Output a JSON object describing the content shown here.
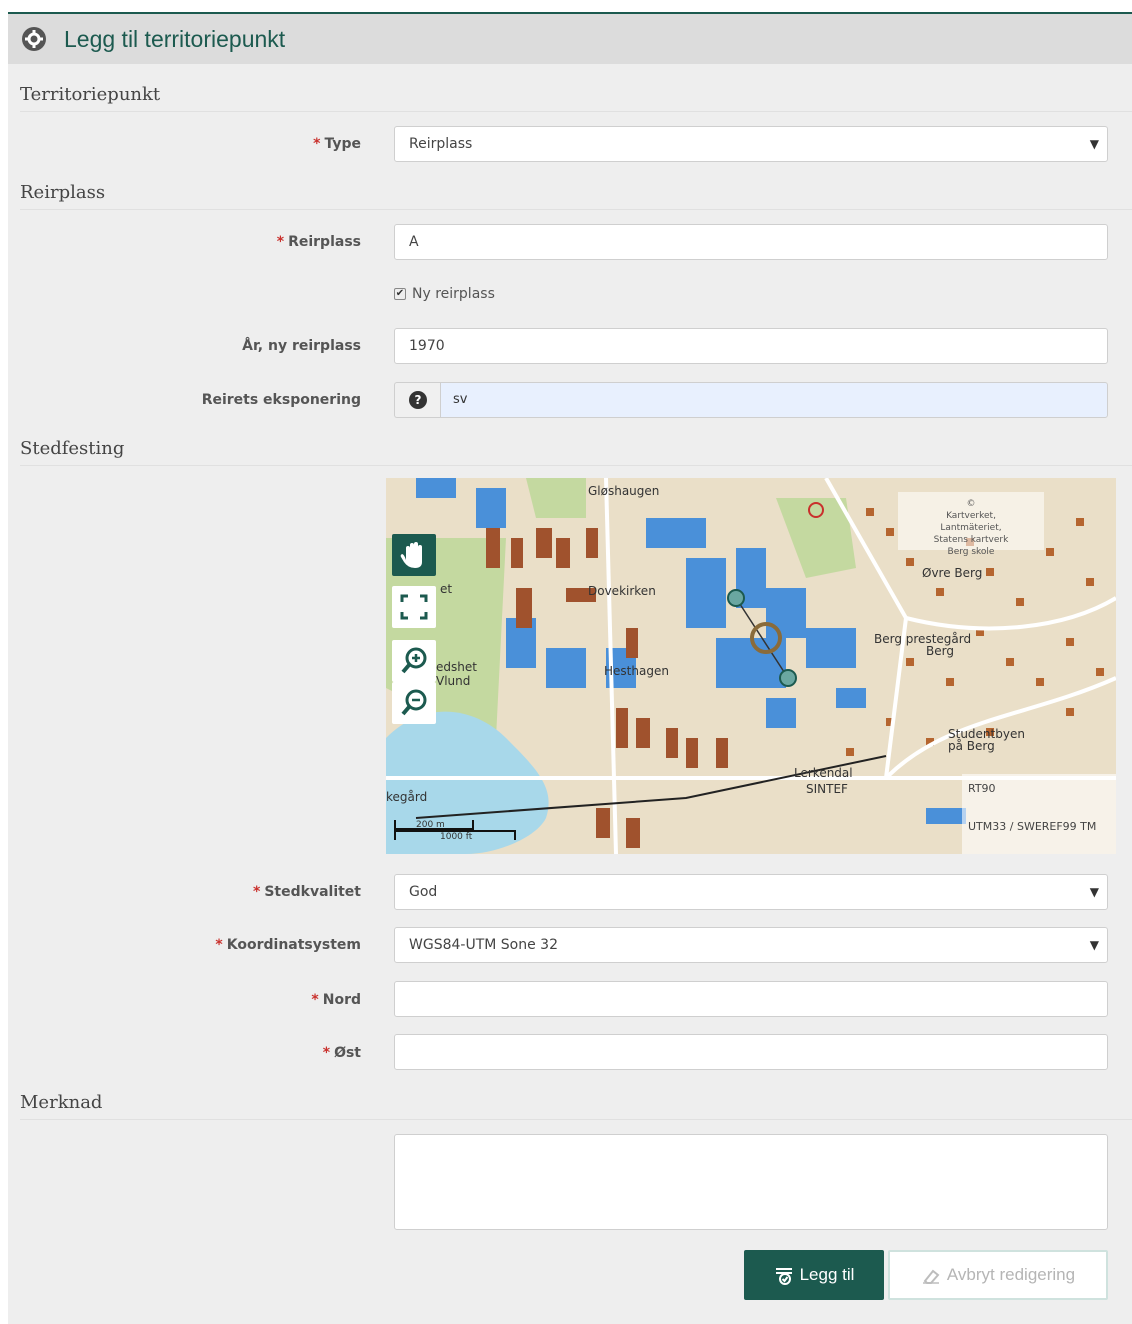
{
  "header": {
    "title": "Legg til territoriepunkt",
    "icon": "gear-icon"
  },
  "sections": {
    "territoriepunkt": "Territoriepunkt",
    "reirplass": "Reirplass",
    "stedfesting": "Stedfesting",
    "merknad": "Merknad"
  },
  "required_mark": "*",
  "fields": {
    "type": {
      "label": "Type",
      "value": "Reirplass"
    },
    "reirplass": {
      "label": "Reirplass",
      "value": "A"
    },
    "ny_reirplass": {
      "label": "Ny reirplass",
      "checked": true
    },
    "aar_ny_reirplass": {
      "label": "År, ny reirplass",
      "value": "1970"
    },
    "eksponering": {
      "label": "Reirets eksponering",
      "value": "sv"
    },
    "stedkvalitet": {
      "label": "Stedkvalitet",
      "value": "God"
    },
    "koordinatsystem": {
      "label": "Koordinatsystem",
      "value": "WGS84-UTM Sone 32"
    },
    "nord": {
      "label": "Nord",
      "value": ""
    },
    "ost": {
      "label": "Øst",
      "value": ""
    },
    "merknad": {
      "value": ""
    }
  },
  "map": {
    "place_labels": [
      "Gløshaugen",
      "Dovekirken",
      "Hesthagen",
      "Øvre Berg",
      "Berg prestegård",
      "Berg",
      "Studentbyen på Berg",
      "Lerkendal",
      "SINTEF",
      "edshet",
      "Vlund",
      "kegård",
      "et"
    ],
    "attribution": [
      "©",
      "Kartverket,",
      "Lantmäteriet,",
      "Statens kartverk",
      "Berg skole"
    ],
    "projections": [
      "RT90",
      "UTM33 / SWEREF99 TM"
    ],
    "scale": [
      "200 m",
      "1000 ft"
    ],
    "controls": [
      "hand-icon",
      "fullscreen-icon",
      "zoom-in-icon",
      "zoom-out-icon"
    ]
  },
  "buttons": {
    "add": "Legg til",
    "cancel": "Avbryt redigering"
  },
  "colors": {
    "brand": "#1c5a4f",
    "required": "#c9302c",
    "water": "#a8d8ea",
    "building": "#4a90d9",
    "house": "#a0522d"
  }
}
